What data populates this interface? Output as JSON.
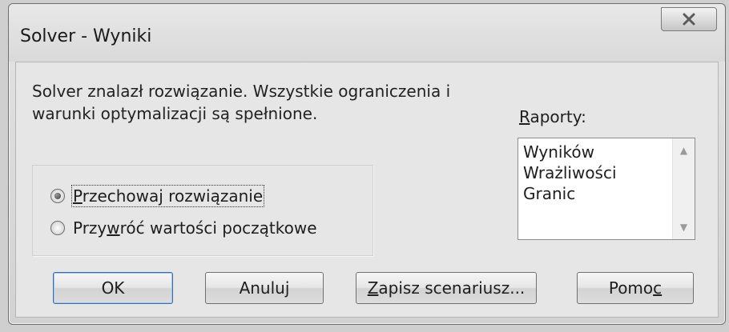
{
  "window": {
    "title": "Solver - Wyniki",
    "close_icon": "close-icon"
  },
  "message": {
    "line1": "Solver znalazł rozwiązanie.  Wszystkie ograniczenia i",
    "line2": "warunki optymalizacji są spełnione."
  },
  "options": [
    {
      "label_pre": "",
      "label_key": "P",
      "label_post": "rzechowaj rozwiązanie",
      "checked": true
    },
    {
      "label_pre": "Przy",
      "label_key": "w",
      "label_post": "róć wartości początkowe",
      "checked": false
    }
  ],
  "reports": {
    "label_key": "R",
    "label_rest": "aporty:",
    "items": [
      "Wyników",
      "Wrażliwości",
      "Granic"
    ]
  },
  "buttons": {
    "ok": "OK",
    "cancel": "Anuluj",
    "save_key": "Z",
    "save_rest": "apisz scenariusz...",
    "help_pre": "Pomo",
    "help_key": "c"
  }
}
